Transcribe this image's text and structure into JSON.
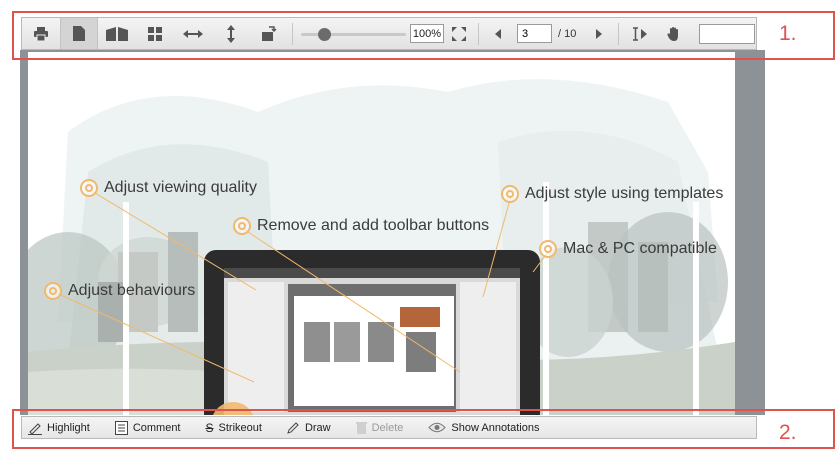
{
  "toolbar_top": {
    "buttons": [
      {
        "id": "print",
        "icon": "printer-icon"
      },
      {
        "id": "single-page",
        "icon": "single-page-icon",
        "active": true
      },
      {
        "id": "two-page",
        "icon": "book-icon"
      },
      {
        "id": "thumbnails",
        "icon": "grid-icon"
      },
      {
        "id": "fit-width",
        "icon": "fit-width-icon"
      },
      {
        "id": "fit-height",
        "icon": "fit-height-icon"
      },
      {
        "id": "rotate",
        "icon": "rotate-icon"
      }
    ],
    "zoom_slider_value": 0.19,
    "zoom_label": "100%",
    "page_current": "3",
    "page_total": "/ 10"
  },
  "document": {
    "callouts": {
      "viewing_quality": "Adjust viewing quality",
      "toolbar_buttons": "Remove and add toolbar buttons",
      "behaviours": "Adjust behaviours",
      "style_templates": "Adjust style using templates",
      "mac_pc": "Mac & PC compatible"
    }
  },
  "toolbar_bottom": {
    "highlight": "Highlight",
    "comment": "Comment",
    "strikeout": "Strikeout",
    "draw": "Draw",
    "delete": "Delete",
    "show_annotations": "Show Annotations"
  },
  "markers": {
    "top": "1.",
    "bottom": "2."
  },
  "colors": {
    "marker_red": "#e0524d",
    "callout_orange": "#f1b96c",
    "viewer_gray": "#8d9296"
  }
}
